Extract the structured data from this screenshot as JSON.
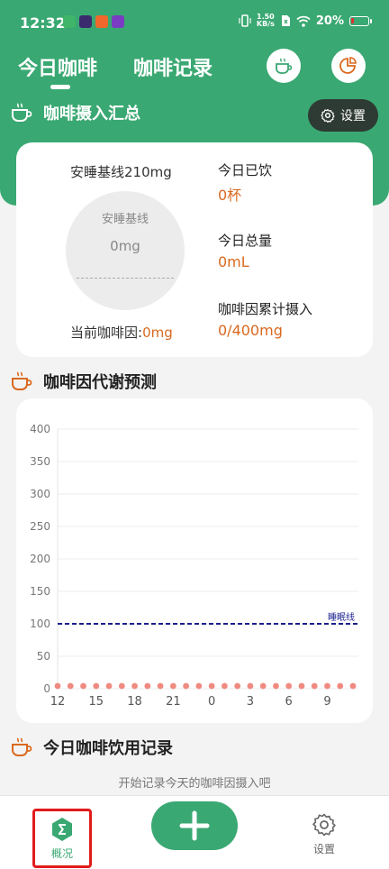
{
  "status_bar": {
    "time": "12:32",
    "speed_value": "1.50",
    "speed_unit": "KB/s",
    "battery": "20%",
    "battery_level": 0.2
  },
  "tabs": [
    {
      "label": "今日咖啡",
      "active": true
    },
    {
      "label": "咖啡记录",
      "active": false
    }
  ],
  "header_icons": [
    "coffee-cup-icon",
    "pie-chart-icon"
  ],
  "summary": {
    "title": "咖啡摄入汇总",
    "settings_label": "设置",
    "baseline_title": "安睡基线210mg",
    "gauge_label": "安睡基线",
    "gauge_value": "0mg",
    "current_label": "当前咖啡因:",
    "current_value": "0mg",
    "stats": [
      {
        "label": "今日已饮",
        "value": "0杯"
      },
      {
        "label": "今日总量",
        "value": "0mL"
      },
      {
        "label": "咖啡因累计摄入",
        "value": "0/400mg"
      }
    ]
  },
  "metabolism": {
    "title": "咖啡因代谢预测"
  },
  "chart_data": {
    "type": "line",
    "x": [
      12,
      13,
      14,
      15,
      16,
      17,
      18,
      19,
      20,
      21,
      22,
      23,
      0,
      1,
      2,
      3,
      4,
      5,
      6,
      7,
      8,
      9,
      10,
      11
    ],
    "x_tick_labels": [
      "12",
      "15",
      "18",
      "21",
      "0",
      "3",
      "6",
      "9"
    ],
    "y_ticks": [
      0,
      50,
      100,
      150,
      200,
      250,
      300,
      350,
      400
    ],
    "ylim": [
      0,
      400
    ],
    "series": [
      {
        "values": [
          0,
          0,
          0,
          0,
          0,
          0,
          0,
          0,
          0,
          0,
          0,
          0,
          0,
          0,
          0,
          0,
          0,
          0,
          0,
          0,
          0,
          0,
          0,
          0
        ],
        "color": "#f08a80"
      }
    ],
    "reference_line": {
      "label": "睡眠线",
      "value": 100,
      "color": "#1a1f8c"
    },
    "grid": true
  },
  "records": {
    "title": "今日咖啡饮用记录",
    "empty_hint": "开始记录今天的咖啡因摄入吧"
  },
  "bottom_nav": {
    "overview_label": "概况",
    "settings_label": "设置"
  },
  "colors": {
    "primary": "#3aa872",
    "accent": "#d9691f",
    "selection_outline": "#e11b1b"
  }
}
